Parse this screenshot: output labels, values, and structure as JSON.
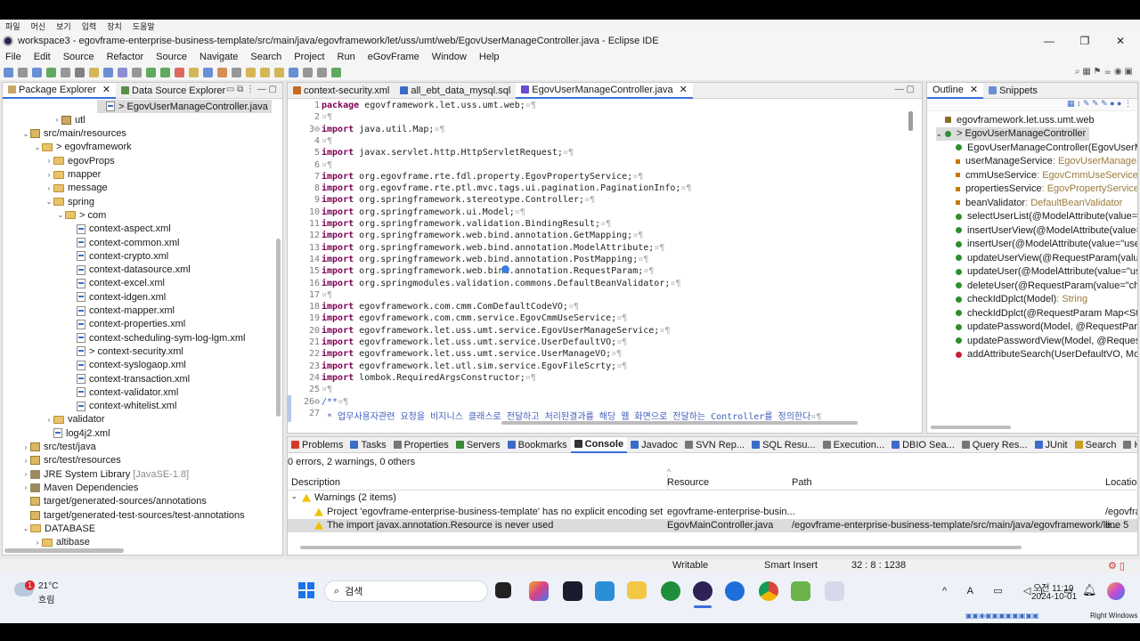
{
  "vm_menu": [
    "파일",
    "머신",
    "보기",
    "입력",
    "장치",
    "도움말"
  ],
  "window": {
    "title": "workspace3 - egovframe-enterprise-business-template/src/main/java/egovframework/let/uss/umt/web/EgovUserManageController.java - Eclipse IDE",
    "minimize": "—",
    "maximize": "❐",
    "close": "✕"
  },
  "menubar": [
    "File",
    "Edit",
    "Source",
    "Refactor",
    "Source",
    "Navigate",
    "Search",
    "Project",
    "Run",
    "eGovFrame",
    "Window",
    "Help"
  ],
  "left_panel": {
    "tabs": [
      "Package Explorer",
      "Data Source Explorer"
    ],
    "tree": [
      {
        "label": "> EgovUserManageController.java",
        "indent": 0,
        "type": "java",
        "arrow": ""
      },
      {
        "label": "utl",
        "indent": 0,
        "type": "pkg",
        "arrow": "›"
      },
      {
        "label": "src/main/resources",
        "indent": 1,
        "type": "src",
        "arrow": "⌄"
      },
      {
        "label": "> egovframework",
        "indent": 2,
        "type": "folder",
        "arrow": "⌄"
      },
      {
        "label": "egovProps",
        "indent": 3,
        "type": "folder",
        "arrow": "›"
      },
      {
        "label": "mapper",
        "indent": 3,
        "type": "folder",
        "arrow": "›"
      },
      {
        "label": "message",
        "indent": 3,
        "type": "folder",
        "arrow": "›"
      },
      {
        "label": "spring",
        "indent": 3,
        "type": "folder",
        "arrow": "⌄"
      },
      {
        "label": "> com",
        "indent": 4,
        "type": "folder",
        "arrow": "⌄"
      },
      {
        "label": "context-aspect.xml",
        "indent": 5,
        "type": "xml",
        "arrow": ""
      },
      {
        "label": "context-common.xml",
        "indent": 5,
        "type": "xml",
        "arrow": ""
      },
      {
        "label": "context-crypto.xml",
        "indent": 5,
        "type": "xml",
        "arrow": ""
      },
      {
        "label": "context-datasource.xml",
        "indent": 5,
        "type": "xml",
        "arrow": ""
      },
      {
        "label": "context-excel.xml",
        "indent": 5,
        "type": "xml",
        "arrow": ""
      },
      {
        "label": "context-idgen.xml",
        "indent": 5,
        "type": "xml",
        "arrow": ""
      },
      {
        "label": "context-mapper.xml",
        "indent": 5,
        "type": "xml",
        "arrow": ""
      },
      {
        "label": "context-properties.xml",
        "indent": 5,
        "type": "xml",
        "arrow": ""
      },
      {
        "label": "context-scheduling-sym-log-lgm.xml",
        "indent": 5,
        "type": "xml",
        "arrow": ""
      },
      {
        "label": "> context-security.xml",
        "indent": 5,
        "type": "xml",
        "arrow": ""
      },
      {
        "label": "context-syslogaop.xml",
        "indent": 5,
        "type": "xml",
        "arrow": ""
      },
      {
        "label": "context-transaction.xml",
        "indent": 5,
        "type": "xml",
        "arrow": ""
      },
      {
        "label": "context-validator.xml",
        "indent": 5,
        "type": "xml",
        "arrow": ""
      },
      {
        "label": "context-whitelist.xml",
        "indent": 5,
        "type": "xml",
        "arrow": ""
      },
      {
        "label": "validator",
        "indent": 3,
        "type": "folder",
        "arrow": "›"
      },
      {
        "label": "log4j2.xml",
        "indent": 3,
        "type": "xml",
        "arrow": ""
      },
      {
        "label": "src/test/java",
        "indent": 1,
        "type": "src",
        "arrow": "›"
      },
      {
        "label": "src/test/resources",
        "indent": 1,
        "type": "src",
        "arrow": "›"
      },
      {
        "label": "JRE System Library",
        "suffix": "[JavaSE-1.8]",
        "indent": 1,
        "type": "jar",
        "arrow": "›"
      },
      {
        "label": "Maven Dependencies",
        "indent": 1,
        "type": "jar",
        "arrow": "›"
      },
      {
        "label": "target/generated-sources/annotations",
        "indent": 1,
        "type": "src",
        "arrow": ""
      },
      {
        "label": "target/generated-test-sources/test-annotations",
        "indent": 1,
        "type": "src",
        "arrow": ""
      },
      {
        "label": "DATABASE",
        "indent": 1,
        "type": "folder",
        "arrow": "⌄"
      },
      {
        "label": "altibase",
        "indent": 2,
        "type": "folder",
        "arrow": "›"
      }
    ]
  },
  "editor": {
    "tabs": [
      "context-security.xml",
      "all_ebt_data_mysql.sql",
      "EgovUserManageController.java"
    ],
    "lines": [
      {
        "n": "1",
        "kw": "package",
        "text": " egovframework.let.uss.umt.web;",
        "ws": "¤¶"
      },
      {
        "n": "2",
        "kw": "",
        "text": "",
        "ws": "¤¶"
      },
      {
        "n": "3⊖",
        "kw": "import",
        "text": " java.util.Map;",
        "ws": "¤¶"
      },
      {
        "n": "4",
        "kw": "",
        "text": "",
        "ws": "¤¶"
      },
      {
        "n": "5",
        "kw": "import",
        "text": " javax.servlet.http.HttpServletRequest;",
        "ws": "¤¶"
      },
      {
        "n": "6",
        "kw": "",
        "text": "",
        "ws": "¤¶"
      },
      {
        "n": "7",
        "kw": "import",
        "text": " org.egovframe.rte.fdl.property.EgovPropertyService;",
        "ws": "¤¶"
      },
      {
        "n": "8",
        "kw": "import",
        "text": " org.egovframe.rte.ptl.mvc.tags.ui.pagination.PaginationInfo;",
        "ws": "¤¶"
      },
      {
        "n": "9",
        "kw": "import",
        "text": " org.springframework.stereotype.Controller;",
        "ws": "¤¶"
      },
      {
        "n": "10",
        "kw": "import",
        "text": " org.springframework.ui.Model;",
        "ws": "¤¶"
      },
      {
        "n": "11",
        "kw": "import",
        "text": " org.springframework.validation.BindingResult;",
        "ws": "¤¶"
      },
      {
        "n": "12",
        "kw": "import",
        "text": " org.springframework.web.bind.annotation.GetMapping;",
        "ws": "¤¶"
      },
      {
        "n": "13",
        "kw": "import",
        "text": " org.springframework.web.bind.annotation.ModelAttribute;",
        "ws": "¤¶"
      },
      {
        "n": "14",
        "kw": "import",
        "text": " org.springframework.web.bind.annotation.PostMapping;",
        "ws": "¤¶"
      },
      {
        "n": "15",
        "kw": "import",
        "text": " org.springframework.web.bind.annotation.RequestParam;",
        "ws": "¤¶"
      },
      {
        "n": "16",
        "kw": "import",
        "text": " org.springmodules.validation.commons.DefaultBeanValidator;",
        "ws": "¤¶"
      },
      {
        "n": "17",
        "kw": "",
        "text": "",
        "ws": "¤¶"
      },
      {
        "n": "18",
        "kw": "import",
        "text": " egovframework.com.cmm.ComDefaultCodeVO;",
        "ws": "¤¶"
      },
      {
        "n": "19",
        "kw": "import",
        "text": " egovframework.com.cmm.service.EgovCmmUseService;",
        "ws": "¤¶"
      },
      {
        "n": "20",
        "kw": "import",
        "text": " egovframework.let.uss.umt.service.EgovUserManageService;",
        "ws": "¤¶"
      },
      {
        "n": "21",
        "kw": "import",
        "text": " egovframework.let.uss.umt.service.UserDefaultVO;",
        "ws": "¤¶"
      },
      {
        "n": "22",
        "kw": "import",
        "text": " egovframework.let.uss.umt.service.UserManageVO;",
        "ws": "¤¶"
      },
      {
        "n": "23",
        "kw": "import",
        "text": " egovframework.let.utl.sim.service.EgovFileScrty;",
        "ws": "¤¶"
      },
      {
        "n": "24",
        "kw": "import",
        "text": " lombok.RequiredArgsConstructor;",
        "ws": "¤¶"
      },
      {
        "n": "25",
        "kw": "",
        "text": "",
        "ws": "¤¶"
      },
      {
        "n": "26⊖",
        "kw": "",
        "text": "/**",
        "ws": "¤¶",
        "comment": true
      },
      {
        "n": "27",
        "kw": "",
        "text": " * 업무사용자관련 요청을 비지니스 클래스로 전달하고 처리된결과를 해당 웹 화면으로 전달하는 Controller를 정의한다",
        "ws": "¤¶",
        "comment": true
      }
    ]
  },
  "outline": {
    "tabs": [
      "Outline",
      "Snippets"
    ],
    "items": [
      {
        "label": "egovframework.let.uss.umt.web",
        "type": "",
        "color": "#8a6c2c",
        "kind": "pkg"
      },
      {
        "label": "> EgovUserManageController",
        "type": "",
        "color": "#2d8f2d",
        "kind": "class"
      },
      {
        "label": "EgovUserManageController(EgovUserMan",
        "type": "",
        "color": "#2d8f2d",
        "kind": "ctor"
      },
      {
        "label": "userManageService",
        "type": " : EgovUserManageSer",
        "color": "#c87a00",
        "kind": "field"
      },
      {
        "label": "cmmUseService",
        "type": " : EgovCmmUseService",
        "color": "#c87a00",
        "kind": "field"
      },
      {
        "label": "propertiesService",
        "type": " : EgovPropertyService",
        "color": "#c87a00",
        "kind": "field"
      },
      {
        "label": "beanValidator",
        "type": " : DefaultBeanValidator",
        "color": "#c87a00",
        "kind": "field"
      },
      {
        "label": "selectUserList(@ModelAttribute(value=\"us",
        "type": "",
        "color": "#2d8f2d",
        "kind": "method"
      },
      {
        "label": "insertUserView(@ModelAttribute(value=\"",
        "type": "",
        "color": "#2d8f2d",
        "kind": "method"
      },
      {
        "label": "insertUser(@ModelAttribute(value=\"userM",
        "type": "",
        "color": "#2d8f2d",
        "kind": "method"
      },
      {
        "label": "updateUserView(@RequestParam(value=\"",
        "type": "",
        "color": "#2d8f2d",
        "kind": "method"
      },
      {
        "label": "updateUser(@ModelAttribute(value=\"use",
        "type": "",
        "color": "#2d8f2d",
        "kind": "method"
      },
      {
        "label": "deleteUser(@RequestParam(value=\"check",
        "type": "",
        "color": "#2d8f2d",
        "kind": "method"
      },
      {
        "label": "checkIdDplct(Model)",
        "type": " : String",
        "color": "#2d8f2d",
        "kind": "method"
      },
      {
        "label": "checkIdDplct(@RequestParam Map<Strin",
        "type": "",
        "color": "#2d8f2d",
        "kind": "method"
      },
      {
        "label": "updatePassword(Model, @RequestParam",
        "type": "",
        "color": "#2d8f2d",
        "kind": "method"
      },
      {
        "label": "updatePasswordView(Model, @RequestPa",
        "type": "",
        "color": "#2d8f2d",
        "kind": "method"
      },
      {
        "label": "addAttributeSearch(UserDefaultVO, Mode",
        "type": "",
        "color": "#c8203a",
        "kind": "private"
      }
    ]
  },
  "bottom": {
    "tabs": [
      "Problems",
      "Tasks",
      "Properties",
      "Servers",
      "Bookmarks",
      "Console",
      "Javadoc",
      "SVN Rep...",
      "SQL Resu...",
      "Execution...",
      "DBIO Sea...",
      "Query Res...",
      "JUnit",
      "Search",
      "History"
    ],
    "summary": "0 errors, 2 warnings, 0 others",
    "columns": [
      "Description",
      "Resource",
      "Path",
      "Location"
    ],
    "group": "Warnings (2 items)",
    "rows": [
      {
        "description": "Project 'egovframe-enterprise-business-template' has no explicit encoding set",
        "resource": "egovframe-enterprise-busin...",
        "path": "",
        "location": "/egovfra"
      },
      {
        "description": "The import javax.annotation.Resource is never used",
        "resource": "EgovMainController.java",
        "path": "/egovframe-enterprise-business-template/src/main/java/egovframework/le...",
        "location": "line 5"
      }
    ]
  },
  "status": {
    "mode": "Writable",
    "insert": "Smart Insert",
    "position": "32 : 8 : 1238"
  },
  "taskbar": {
    "weather_temp": "21°C",
    "weather_desc": "흐림",
    "weather_badge": "1",
    "search": "검색",
    "time": "오전 11:19",
    "date": "2024-10-01",
    "host_key": "Right Windows"
  }
}
